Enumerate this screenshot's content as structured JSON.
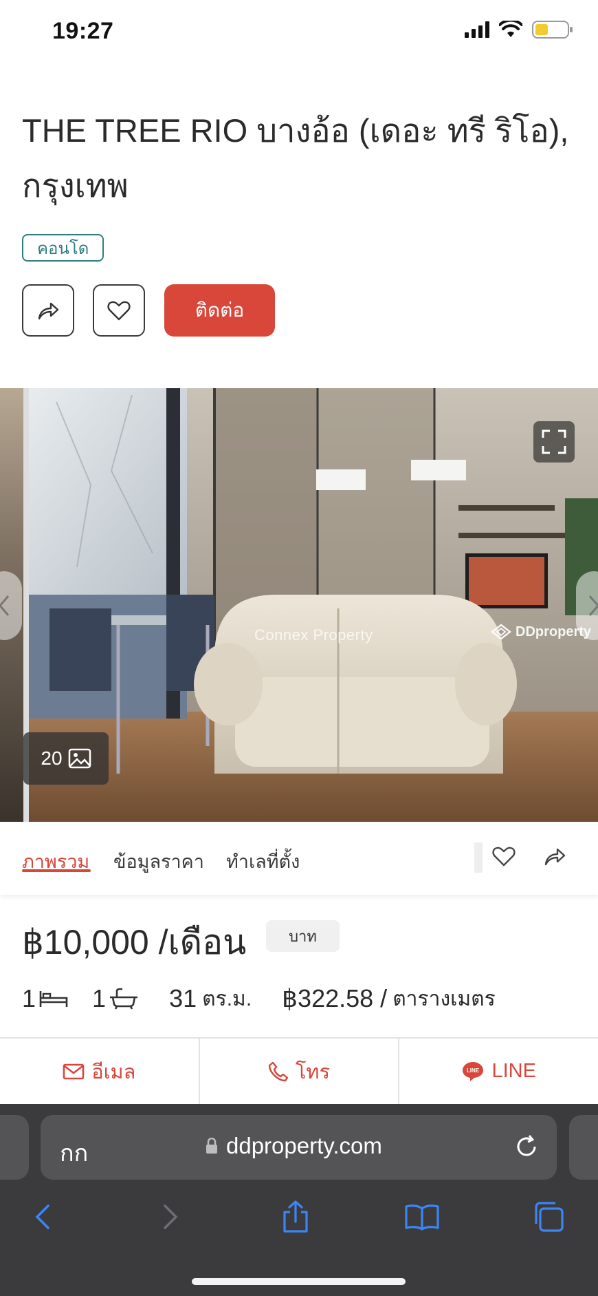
{
  "status_bar": {
    "time": "19:27"
  },
  "listing": {
    "title": "THE TREE RIO บางอ้อ (เดอะ ทรี ริโอ), กรุงเทพ",
    "property_type": "คอนโด",
    "contact_label": "ติดต่อ"
  },
  "gallery": {
    "photo_count": "20",
    "watermark_agency": "Connex Property",
    "watermark_brand": "DDproperty"
  },
  "tabs": {
    "items": [
      {
        "label": "ภาพรวม",
        "active": true
      },
      {
        "label": "ข้อมูลราคา",
        "active": false
      },
      {
        "label": "ทำเลที่ตั้ง",
        "active": false
      }
    ]
  },
  "price": {
    "amount": "฿10,000 /เดือน",
    "currency_badge": "บาท"
  },
  "specs": {
    "bedrooms": "1",
    "bathrooms": "1",
    "area": "31",
    "area_unit": "ตร.ม.",
    "price_per_sqm": "฿322.58 /",
    "price_per_sqm_unit": "ตารางเมตร"
  },
  "contact_strip": {
    "email": "อีเมล",
    "phone": "โทร",
    "line": "LINE"
  },
  "browser": {
    "aa": "กก",
    "url": "ddproperty.com"
  },
  "colors": {
    "accent": "#d9473a",
    "badge_teal": "#2f7d82",
    "browser_bg": "#3b3b3d",
    "browser_blue": "#3b86f7"
  }
}
